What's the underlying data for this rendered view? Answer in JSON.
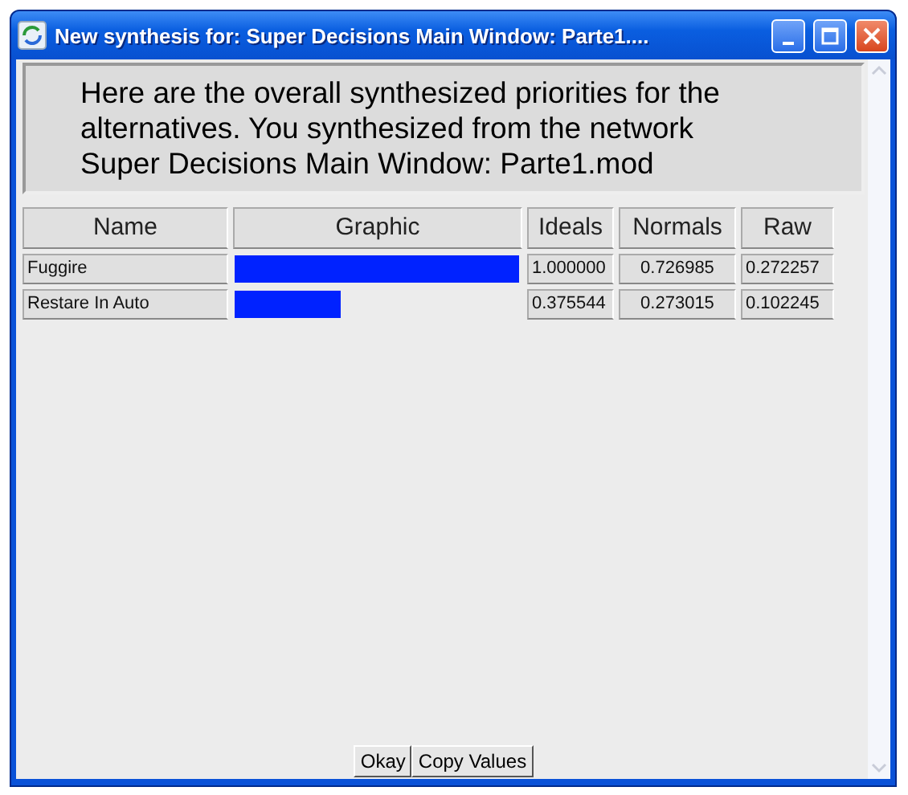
{
  "window": {
    "title": "New synthesis for: Super Decisions Main Window: Parte1...."
  },
  "message": "Here are the overall synthesized priorities for the alternatives.  You synthesized from the network Super Decisions Main Window: Parte1.mod",
  "table": {
    "columns": [
      "Name",
      "Graphic",
      "Ideals",
      "Normals",
      "Raw"
    ],
    "rows": [
      {
        "name": "Fuggire",
        "level": 1.0,
        "ideals": "1.000000",
        "normals": "0.726985",
        "raw": "0.272257"
      },
      {
        "name": "Restare In Auto",
        "level": 0.3755,
        "ideals": "0.375544",
        "normals": "0.273015",
        "raw": "0.102245"
      }
    ]
  },
  "buttons": [
    "Okay",
    "Copy Values"
  ]
}
